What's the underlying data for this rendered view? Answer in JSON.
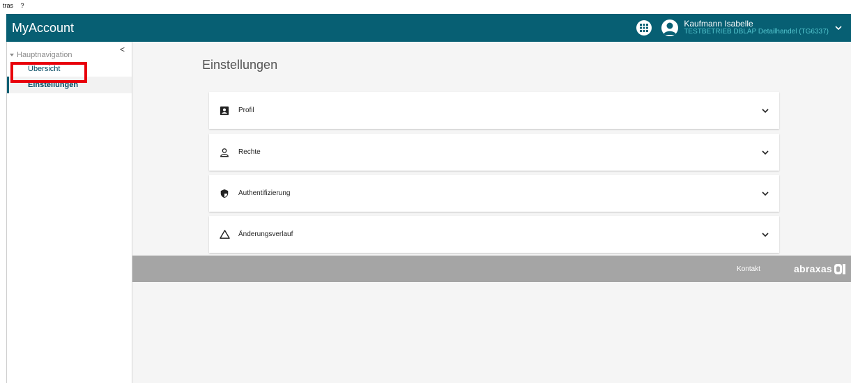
{
  "colors": {
    "brand": "#075f73",
    "accent": "#54c6cf",
    "highlight": "#e8000b"
  },
  "topline": {
    "items": [
      "tras",
      "?"
    ]
  },
  "header": {
    "title": "MyAccount",
    "apps_icon": "apps-grid-icon",
    "user": {
      "name": "Kaufmann Isabelle",
      "org": "TESTBETRIEB DBLAP Detailhandel (TG6337)"
    }
  },
  "sidebar": {
    "section_label": "Hauptnavigation",
    "collapse_label": "<",
    "items": [
      {
        "label": "Übersicht",
        "active": false
      },
      {
        "label": "Einstellungen",
        "active": true
      }
    ]
  },
  "main": {
    "title": "Einstellungen",
    "panels": [
      {
        "label": "Profil",
        "icon": "profile-card-icon"
      },
      {
        "label": "Rechte",
        "icon": "person-icon"
      },
      {
        "label": "Authentifizierung",
        "icon": "shield-icon"
      },
      {
        "label": "Änderungsverlauf",
        "icon": "history-triangle-icon"
      }
    ]
  },
  "footer": {
    "contact_label": "Kontakt",
    "brand_name": "abraxas"
  }
}
